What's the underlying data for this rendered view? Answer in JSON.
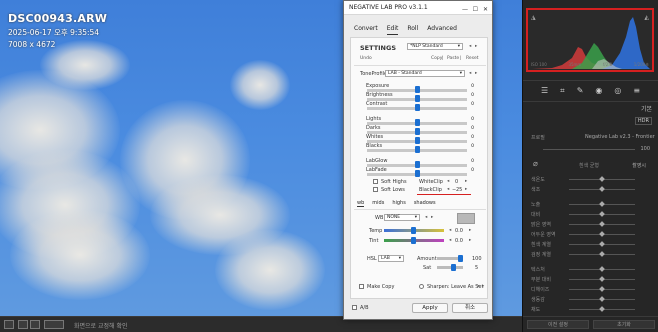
{
  "photo": {
    "filename": "DSC00943.ARW",
    "datetime": "2025-06-17 오후 9:35:54",
    "dimensions": "7008 x 4672"
  },
  "bottom_toolbar": {
    "status_text": "화면으로 교정해 확인"
  },
  "histogram": {
    "colors": {
      "red": "#d23b3b",
      "green": "#3aa04a",
      "blue": "#2f6fd8",
      "border": "#d62020"
    },
    "labels": [
      "ISO 100",
      "35mm",
      "f/2.8",
      "1/200초"
    ]
  },
  "right_panel": {
    "section_title": "기본",
    "hdr_label": "HDR",
    "profile_label": "프로필",
    "profile_value": "Negative Lab v2.3 - Frontier",
    "amount_value": "100",
    "wb_label": "흰색 균형",
    "wb_value": "촬영시",
    "rows": [
      "색온도",
      "색조",
      "노출",
      "대비",
      "밝은 영역",
      "어두운 영역",
      "흰색 계열",
      "검정 계열",
      "텍스처",
      "부분 대비",
      "디헤이즈",
      "생동감",
      "채도"
    ],
    "footer_prev": "이전 설정",
    "footer_reset": "초기화"
  },
  "dialog": {
    "title": "NEGATIVE LAB PRO v3.1.1",
    "tabs": [
      {
        "label": "Convert",
        "active": false
      },
      {
        "label": "Edit",
        "active": true
      },
      {
        "label": "Roll",
        "active": false
      },
      {
        "label": "Advanced",
        "active": false
      }
    ],
    "settings_label": "SETTINGS",
    "settings_value": "*NLP Standard",
    "undo_label": "Undo",
    "copy_label": "Copy",
    "paste_label": "Paste",
    "reset_label": "Reset",
    "tone_profile_label": "ToneProfile",
    "tone_profile_value": "LAB - Standard",
    "sliders": [
      {
        "label": "Exposure",
        "value": "0",
        "pos": 0.5
      },
      {
        "label": "Brightness",
        "value": "0",
        "pos": 0.5
      },
      {
        "label": "Contrast",
        "value": "0",
        "pos": 0.5
      },
      {
        "label": "Lights",
        "value": "0",
        "pos": 0.5
      },
      {
        "label": "Darks",
        "value": "0",
        "pos": 0.5
      },
      {
        "label": "Whites",
        "value": "0",
        "pos": 0.5
      },
      {
        "label": "Blacks",
        "value": "0",
        "pos": 0.5
      },
      {
        "label": "LabGlow",
        "value": "0",
        "pos": 0.5
      },
      {
        "label": "LabFade",
        "value": "0",
        "pos": 0.5
      }
    ],
    "soft_highs_label": "Soft Highs",
    "soft_lows_label": "Soft Lows",
    "whiteclip_label": "WhiteClip",
    "whiteclip_value": "0",
    "blackclip_label": "BlackClip",
    "blackclip_value": "25",
    "color_tabs": [
      {
        "label": "wb",
        "active": true
      },
      {
        "label": "mids",
        "active": false
      },
      {
        "label": "highs",
        "active": false
      },
      {
        "label": "shadows",
        "active": false
      }
    ],
    "wb_label": "WB",
    "wb_value": "NONE",
    "temp_label": "Temp",
    "temp_value": "0.0",
    "tint_label": "Tint",
    "tint_value": "0.0",
    "hsl_label": "HSL",
    "hsl_value": "LAB",
    "amount_label": "Amount",
    "amount_value": "100",
    "sat_label": "Sat",
    "sat_value": "5",
    "make_copy_label": "Make Copy",
    "sharpen_label": "Sharpen: Leave As Set",
    "ab_label": "A/B",
    "apply_label": "Apply",
    "cancel_label": "취소"
  }
}
